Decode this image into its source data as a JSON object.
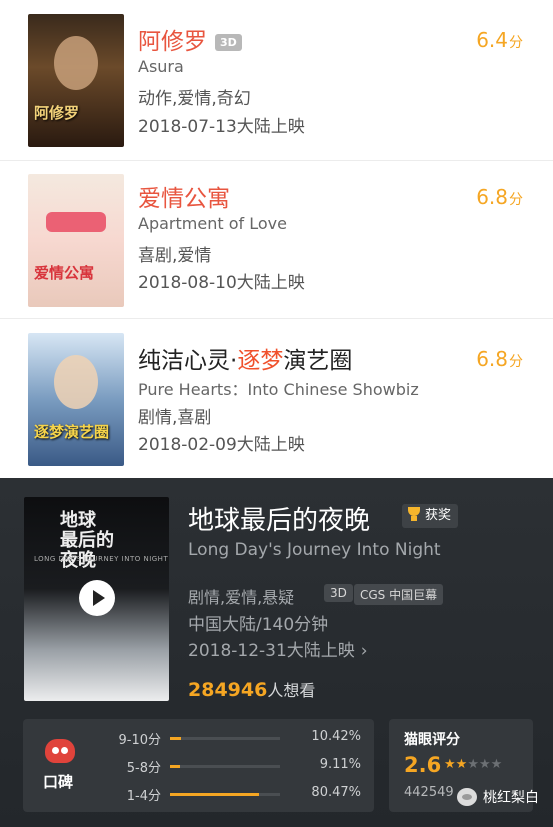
{
  "movies": [
    {
      "title": "阿修罗",
      "tag": "3D",
      "english": "Asura",
      "genres": "动作,爱情,奇幻",
      "release": "2018-07-13大陆上映",
      "score": "6.4",
      "score_unit": "分",
      "poster_text": "阿修罗"
    },
    {
      "title": "爱情公寓",
      "english": "Apartment of Love",
      "genres": "喜剧,爱情",
      "release": "2018-08-10大陆上映",
      "score": "6.8",
      "score_unit": "分",
      "poster_text": "爱情公寓"
    },
    {
      "title_pre": "纯洁心灵·",
      "title_hl": "逐梦",
      "title_post": "演艺圈",
      "english": "Pure Hearts：Into Chinese Showbiz",
      "genres": "剧情,喜剧",
      "release": "2018-02-09大陆上映",
      "score": "6.8",
      "score_unit": "分",
      "poster_text": "逐梦演艺圈"
    }
  ],
  "detail": {
    "title": "地球最后的夜晚",
    "award": "获奖",
    "english": "Long Day's Journey Into Night",
    "genres": "剧情,爱情,悬疑",
    "tag_3d": "3D",
    "tag_cgs": "CGS 中国巨幕",
    "region_duration": "中国大陆/140分钟",
    "release": "2018-12-31大陆上映",
    "chevron": "›",
    "want_count": "284946",
    "want_label": "人想看",
    "poster_title": "地球\n最后的\n夜晚",
    "poster_sub": "LONG DAY'S JOURNEY INTO NIGHT"
  },
  "koubei": {
    "label": "口碑",
    "rows": [
      {
        "range": "9-10分",
        "pct": "10.42%",
        "fraction": 0.1042
      },
      {
        "range": "5-8分",
        "pct": "9.11%",
        "fraction": 0.0911
      },
      {
        "range": "1-4分",
        "pct": "80.47%",
        "fraction": 0.8047
      }
    ]
  },
  "maoyan": {
    "heading": "猫眼评分",
    "score": "2.6",
    "stars_filled": 1.5,
    "stars_total": 5,
    "count": "442549"
  },
  "watermark": "桃红梨白",
  "colors": {
    "accent_orange": "#f5a623",
    "title_red": "#e8553f",
    "dark_bg": "#2c3034"
  }
}
